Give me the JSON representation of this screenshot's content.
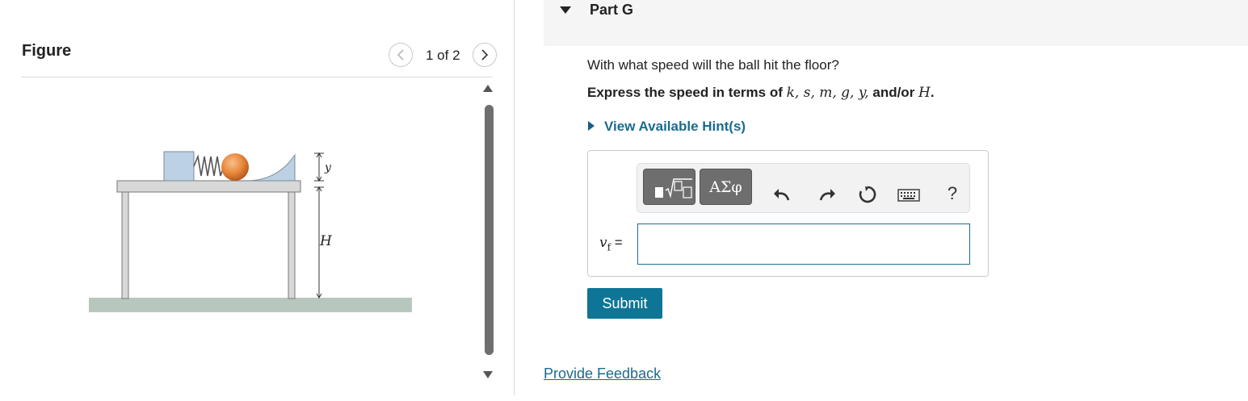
{
  "figure_panel": {
    "title": "Figure",
    "page_counter": "1 of 2",
    "prev_icon": "chevron-left-icon",
    "next_icon": "chevron-right-icon",
    "diagram_labels": {
      "small_height": "y",
      "table_height": "H"
    }
  },
  "part": {
    "title": "Part G",
    "question": "With what speed will the ball hit the floor?",
    "instruction_prefix": "Express the speed in terms of",
    "instruction_vars": "k, s, m, g, y,",
    "instruction_andor": "and/or",
    "instruction_last": "H",
    "instruction_end": ".",
    "hint_link": "View Available Hint(s)"
  },
  "answer": {
    "label_var": "v",
    "label_sub": "f",
    "label_eq": " =",
    "input_value": "",
    "toolbar": {
      "templates_label": "templates",
      "greek_label": "ΑΣφ",
      "help_label": "?"
    },
    "submit_label": "Submit"
  },
  "feedback_link": "Provide Feedback",
  "colors": {
    "accent": "#0e7596",
    "link": "#1a6b8f",
    "toolbar_button": "#6e6e6e",
    "ball": "#e8863a",
    "ground": "#b8c7bd"
  }
}
